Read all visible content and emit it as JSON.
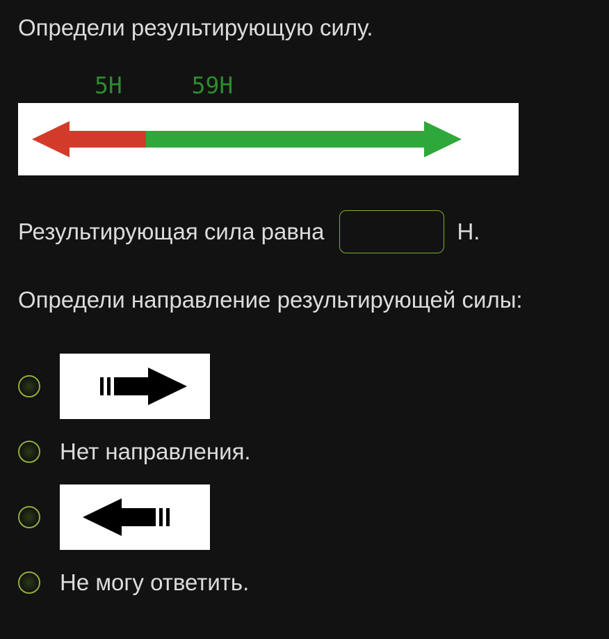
{
  "question": {
    "prompt": "Определи результирующую силу.",
    "force_labels": {
      "left": "5Н",
      "right": "59Н"
    },
    "answer_line_before": "Результирующая сила равна",
    "answer_unit": "Н.",
    "answer_value": "",
    "direction_prompt": "Определи направление результирующей силы:",
    "options": {
      "opt1_icon": "arrow-right",
      "opt2_text": "Нет направления.",
      "opt3_icon": "arrow-left",
      "opt4_text": "Не могу ответить."
    }
  }
}
